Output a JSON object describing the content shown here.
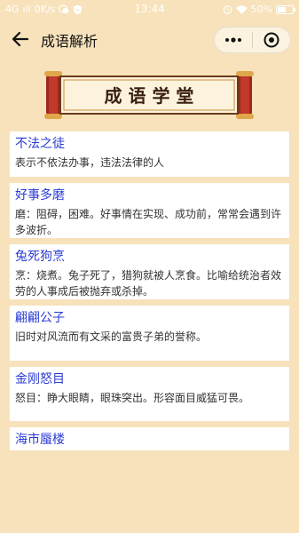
{
  "status_bar": {
    "network": "4G",
    "signal_bars": "ıll",
    "speed": "0K/s",
    "time": "13:44",
    "battery_pct": "50%",
    "battery_level": 0.5
  },
  "nav": {
    "title": "成语解析"
  },
  "banner": {
    "text": "成 语 学 堂"
  },
  "idioms": [
    {
      "name": "不法之徒",
      "meaning": "表示不依法办事，违法法律的人"
    },
    {
      "name": "好事多磨",
      "meaning": "磨：阻碍，困难。好事情在实现、成功前，常常会遇到许多波折。"
    },
    {
      "name": "兔死狗烹",
      "meaning": "烹：烧煮。兔子死了，猎狗就被人烹食。比喻给统治者效劳的人事成后被抛弃或杀掉。"
    },
    {
      "name": "翩翩公子",
      "meaning": "旧时对风流而有文采的富贵子弟的誉称。"
    },
    {
      "name": "金刚怒目",
      "meaning": "怒目：睁大眼睛，眼珠突出。形容面目威猛可畏。"
    },
    {
      "name": "海市蜃楼",
      "meaning": ""
    }
  ],
  "colors": {
    "background": "#f7e2bb",
    "idiom_link": "#2a3bd6",
    "banner_red": "#c0392b"
  }
}
